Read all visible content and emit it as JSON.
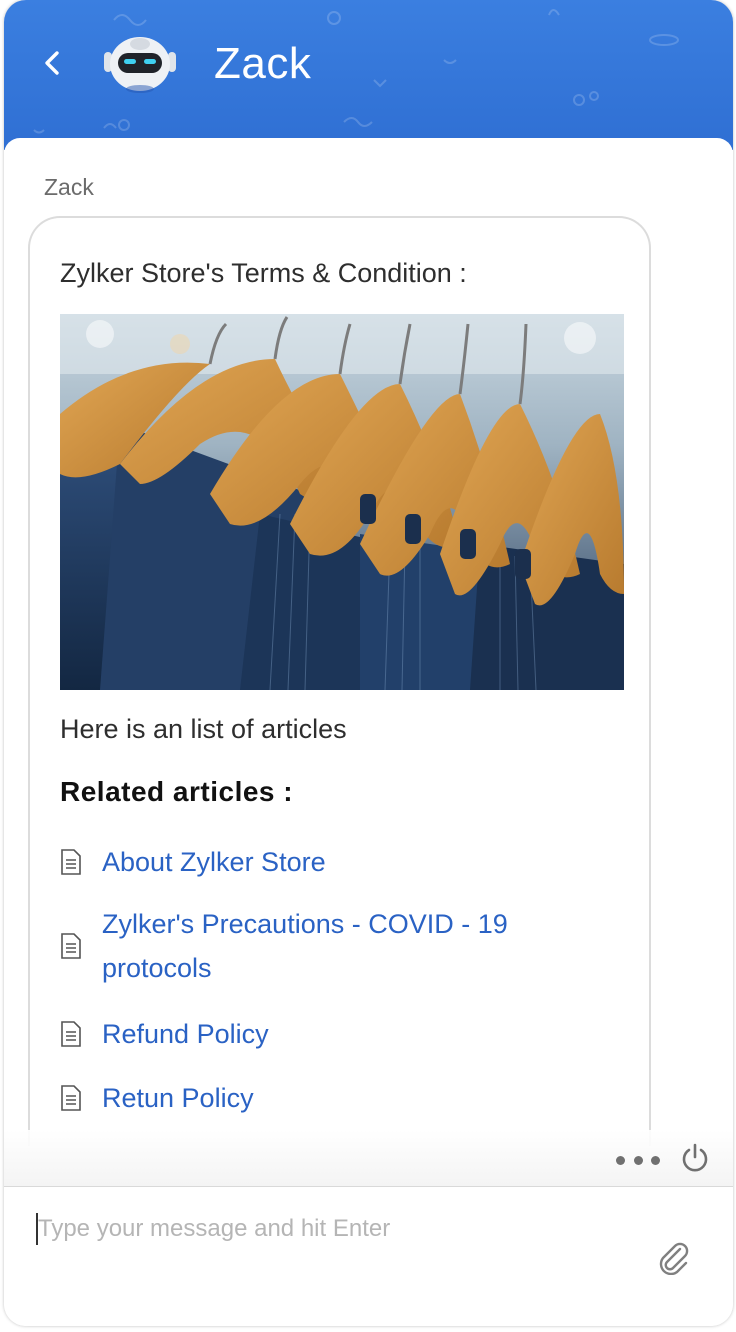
{
  "header": {
    "title": "Zack",
    "back_icon": "chevron-left-icon",
    "avatar_icon": "robot-avatar"
  },
  "message": {
    "sender": "Zack",
    "title": "Zylker Store's Terms & Condition :",
    "image_alt": "clothes on wooden hangers",
    "text": "Here is an list of articles",
    "related_heading": "Related articles :",
    "articles": [
      {
        "label": "About Zylker Store",
        "icon": "document-icon"
      },
      {
        "label": "Zylker's Precautions - COVID - 19 protocols",
        "icon": "document-icon"
      },
      {
        "label": "Refund Policy",
        "icon": "document-icon"
      },
      {
        "label": "Retun Policy",
        "icon": "document-icon"
      }
    ]
  },
  "actions": {
    "more_icon": "more-dots-icon",
    "power_icon": "power-icon"
  },
  "composer": {
    "placeholder": "Type your message and hit Enter",
    "value": "",
    "attach_icon": "paperclip-icon"
  },
  "colors": {
    "header_blue": "#2f6fd3",
    "link_blue": "#2a62c4"
  }
}
